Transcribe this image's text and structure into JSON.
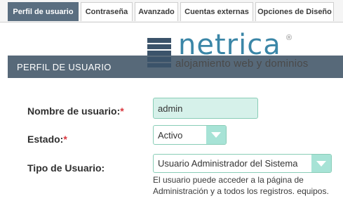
{
  "tabs": [
    {
      "label": "Perfil de usuario",
      "active": true
    },
    {
      "label": "Contraseña",
      "active": false
    },
    {
      "label": "Avanzado",
      "active": false
    },
    {
      "label": "Cuentas externas",
      "active": false
    },
    {
      "label": "Opciones de Diseño",
      "active": false
    }
  ],
  "logo": {
    "word": "netrica",
    "registered": "®",
    "tagline": "alojamiento web y dominios"
  },
  "section": {
    "title": "PERFIL DE USUARIO"
  },
  "fields": {
    "username": {
      "label": "Nombre de usuario:",
      "required": "*",
      "value": "admin"
    },
    "status": {
      "label": "Estado:",
      "required": "*",
      "value": "Activo"
    },
    "user_type": {
      "label": "Tipo de Usuario:",
      "value": "Usuario Administrador del Sistema",
      "help": "El usuario puede acceder a la página de Administración y a todos los registros. equipos."
    }
  },
  "colors": {
    "tab_active": "#5a6e80",
    "header_bg": "#576979",
    "input_bg": "#d6f1ea",
    "input_border": "#89cdb7",
    "select_arrow": "#a7e3d6",
    "required": "#d9363e",
    "logo_blue": "#3b86a7",
    "logo_mark": "#3b536a"
  },
  "icons": {
    "select_arrow": "chevron-down-icon",
    "logo": "server-stack-icon"
  }
}
